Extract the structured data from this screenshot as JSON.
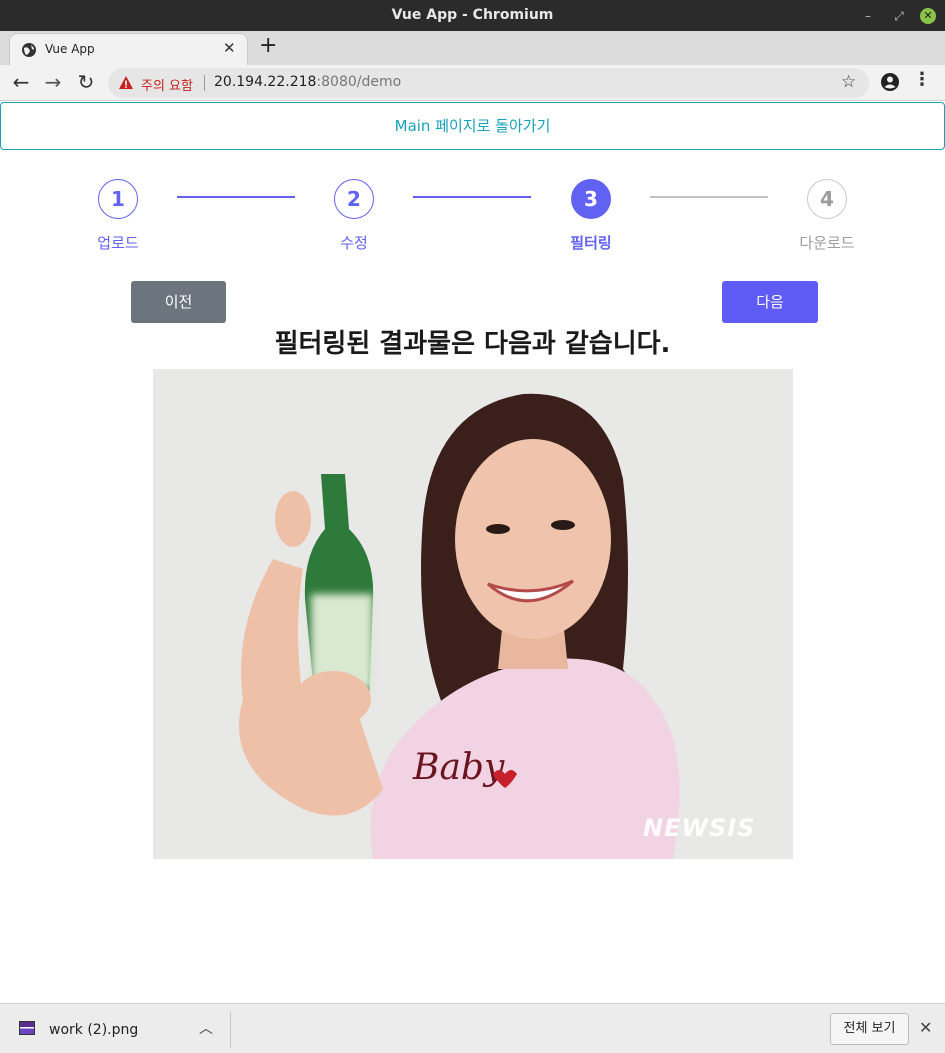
{
  "window": {
    "title": "Vue App - Chromium"
  },
  "tab": {
    "title": "Vue App"
  },
  "toolbar": {
    "security_label": "주의 요함",
    "url_host": "20.194.22.218",
    "url_rest": ":8080/demo"
  },
  "page": {
    "main_link": "Main 페이지로 돌아가기",
    "steps": [
      {
        "number": "1",
        "label": "업로드",
        "state": "done"
      },
      {
        "number": "2",
        "label": "수정",
        "state": "done"
      },
      {
        "number": "3",
        "label": "필터링",
        "state": "active"
      },
      {
        "number": "4",
        "label": "다운로드",
        "state": "todo"
      }
    ],
    "prev_label": "이전",
    "next_label": "다음",
    "result_title": "필터링된 결과물은 다음과 같습니다.",
    "image_watermark": "NEWSIS"
  },
  "download_bar": {
    "file_name": "work (2).png",
    "show_all": "전체 보기"
  },
  "colors": {
    "accent": "#6262f2",
    "link": "#17a2b8",
    "prev_button": "#6c757d"
  }
}
